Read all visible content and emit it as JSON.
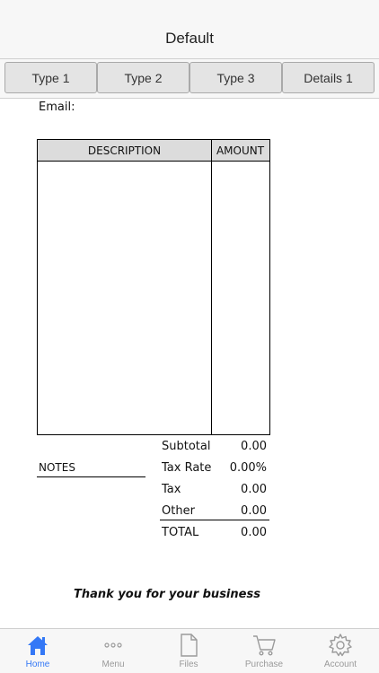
{
  "nav": {
    "title": "Default"
  },
  "segments": [
    {
      "label": "Type 1"
    },
    {
      "label": "Type 2"
    },
    {
      "label": "Type 3"
    },
    {
      "label": "Details 1"
    }
  ],
  "invoice": {
    "email_label": "Email:",
    "table": {
      "description_header": "DESCRIPTION",
      "amount_header": "AMOUNT"
    },
    "notes_label": "NOTES",
    "totals": [
      {
        "label": "Subtotal",
        "value": "0.00"
      },
      {
        "label": "Tax Rate",
        "value": "0.00%"
      },
      {
        "label": "Tax",
        "value": "0.00"
      },
      {
        "label": "Other",
        "value": "0.00"
      },
      {
        "label": "TOTAL",
        "value": "0.00"
      }
    ],
    "thank_you": "Thank you for your business"
  },
  "tabbar": {
    "active_color": "#3478f6",
    "inactive_color": "#9a9a9a",
    "items": [
      {
        "label": "Home",
        "icon": "home-icon",
        "active": true
      },
      {
        "label": "Menu",
        "icon": "more-icon",
        "active": false
      },
      {
        "label": "Files",
        "icon": "file-icon",
        "active": false
      },
      {
        "label": "Purchase",
        "icon": "cart-icon",
        "active": false
      },
      {
        "label": "Account",
        "icon": "gear-icon",
        "active": false
      }
    ]
  }
}
